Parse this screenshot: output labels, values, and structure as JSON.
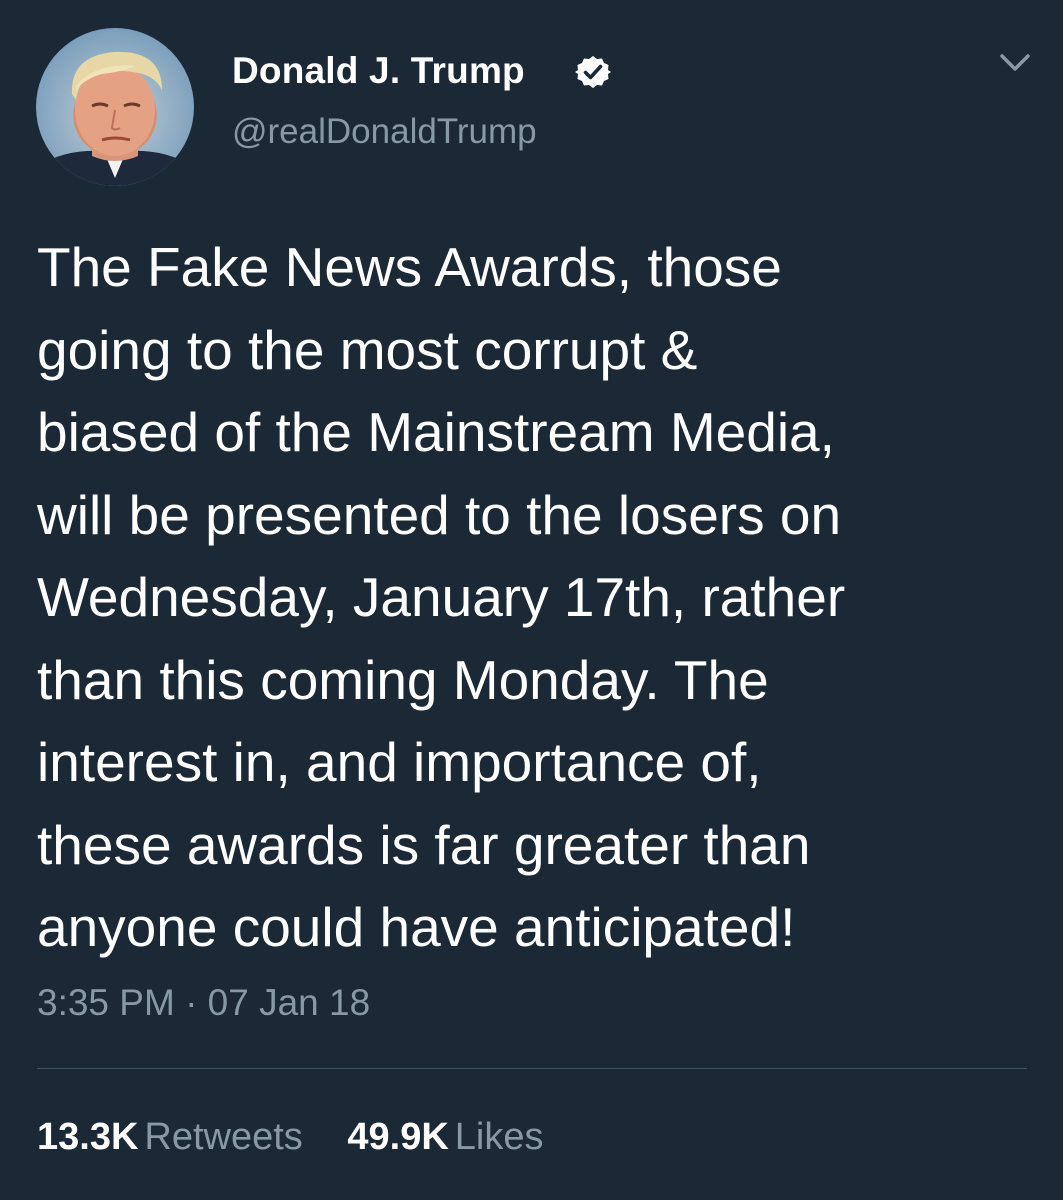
{
  "author": {
    "name": "Donald J. Trump",
    "handle": "@realDonaldTrump",
    "avatar_icon": "profile-photo",
    "verified_icon": "verified-badge-icon"
  },
  "tweet": {
    "text": "The Fake News Awards, those\ngoing to the most corrupt &\nbiased of the Mainstream Media,\nwill be presented to the losers on\nWednesday, January 17th, rather\nthan this coming Monday. The\ninterest in, and importance of,\nthese awards is far greater than\nanyone could have anticipated!",
    "timestamp": "3:35 PM · 07 Jan 18"
  },
  "stats": {
    "retweets_count": "13.3K",
    "retweets_label": "Retweets",
    "likes_count": "49.9K",
    "likes_label": "Likes"
  },
  "menu": {
    "icon": "chevron-down-icon"
  },
  "colors": {
    "background": "#1b2836",
    "text_primary": "#ffffff",
    "text_secondary": "#8899a6",
    "divider": "#3d5466"
  }
}
